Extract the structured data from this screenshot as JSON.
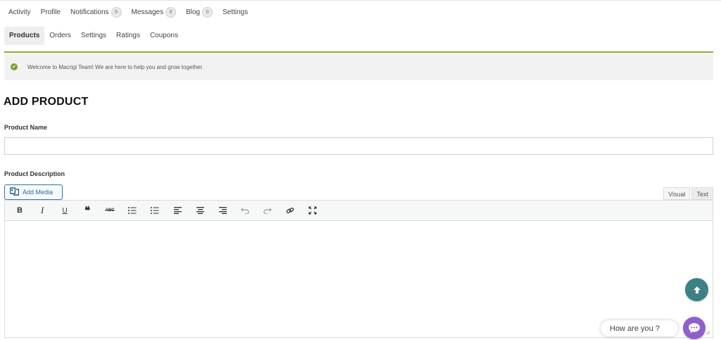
{
  "nav_primary": {
    "activity": "Activity",
    "profile": "Profile",
    "notifications": "Notifications",
    "notifications_count": "0",
    "messages": "Messages",
    "messages_count": "0",
    "blog": "Blog",
    "blog_count": "0",
    "settings": "Settings"
  },
  "nav_secondary": {
    "products": "Products",
    "orders": "Orders",
    "settings": "Settings",
    "ratings": "Ratings",
    "coupons": "Coupons"
  },
  "notice": {
    "text": "Welcome to Macrigi Team! We are here to help you and grow together."
  },
  "page": {
    "title": "ADD PRODUCT",
    "product_name_label": "Product Name",
    "product_description_label": "Product Description"
  },
  "editor": {
    "add_media": "Add Media",
    "visual_tab": "Visual",
    "text_tab": "Text",
    "toolbar": [
      "B",
      "I",
      "U",
      "❝",
      "ABC",
      "bullet-list",
      "numbered-list",
      "align-left",
      "align-center",
      "align-right",
      "undo",
      "redo",
      "link",
      "fullscreen"
    ]
  },
  "chat": {
    "prompt": "How are you ?"
  },
  "colors": {
    "accent_green": "#8cab2c",
    "highlight_yellow": "#ffec1a",
    "scroll_top_bg": "#3c8185",
    "chat_purple": "#8f5fd0",
    "media_blue": "#2a78b5"
  }
}
